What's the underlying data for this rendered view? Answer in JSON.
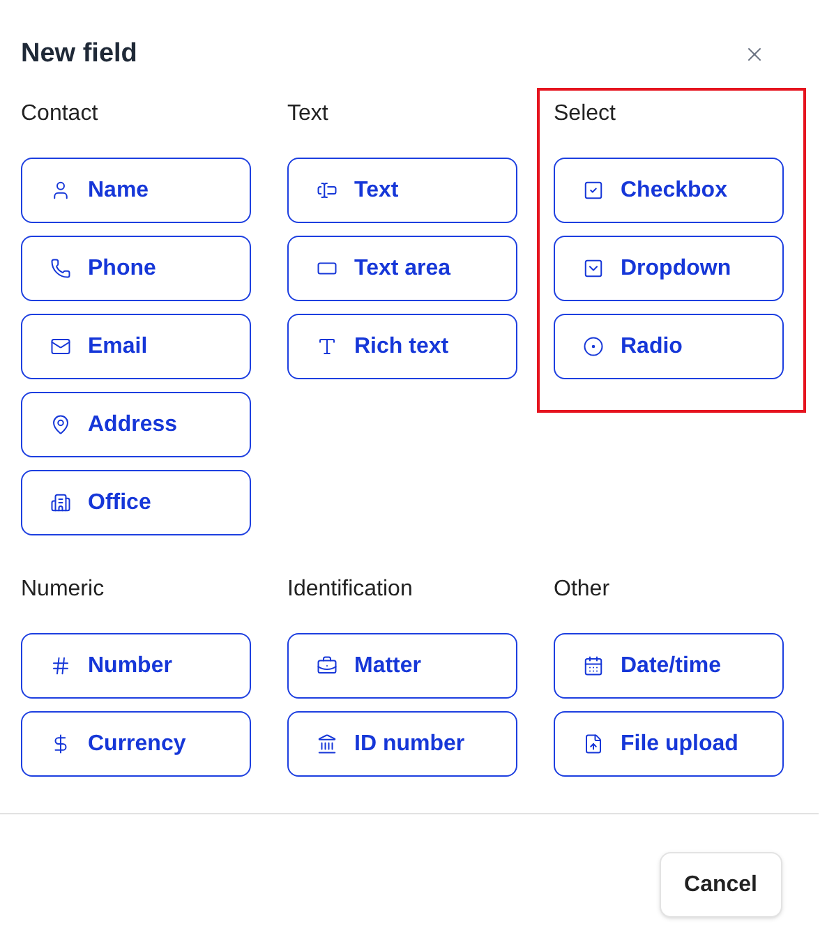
{
  "dialog": {
    "title": "New field"
  },
  "groups": [
    {
      "title": "Contact",
      "highlighted": false,
      "items": [
        "Name",
        "Phone",
        "Email",
        "Address",
        "Office"
      ]
    },
    {
      "title": "Text",
      "highlighted": false,
      "items": [
        "Text",
        "Text area",
        "Rich text"
      ]
    },
    {
      "title": "Select",
      "highlighted": true,
      "items": [
        "Checkbox",
        "Dropdown",
        "Radio"
      ]
    },
    {
      "title": "Numeric",
      "highlighted": false,
      "items": [
        "Number",
        "Currency"
      ]
    },
    {
      "title": "Identification",
      "highlighted": false,
      "items": [
        "Matter",
        "ID number"
      ]
    },
    {
      "title": "Other",
      "highlighted": false,
      "items": [
        "Date/time",
        "File upload"
      ]
    }
  ],
  "footer": {
    "cancel": "Cancel"
  }
}
